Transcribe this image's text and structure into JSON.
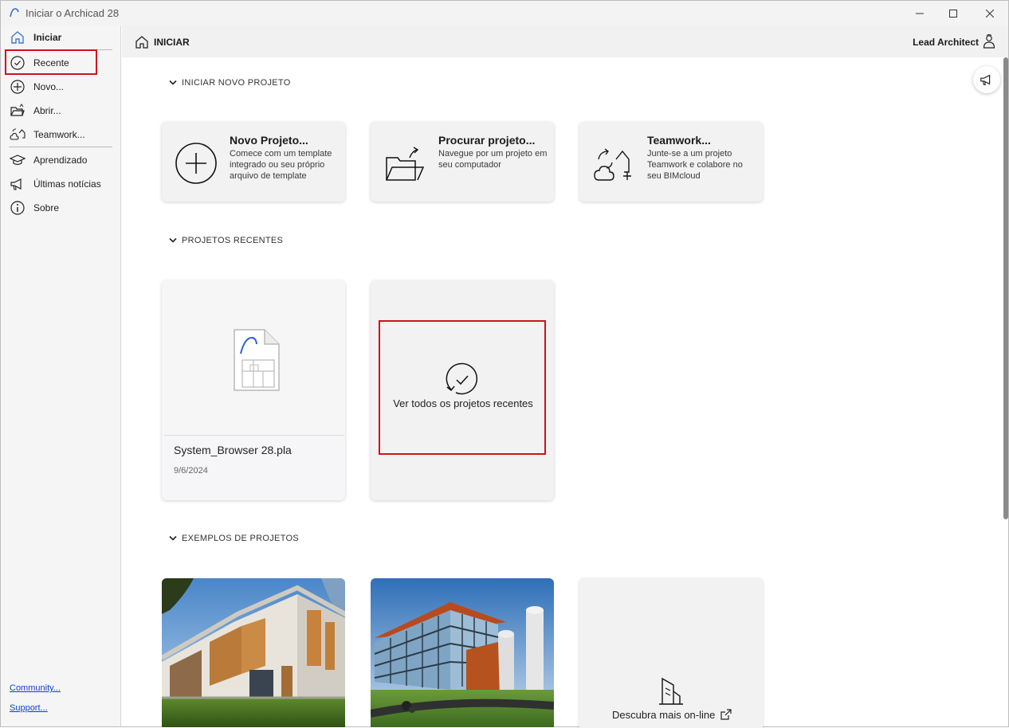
{
  "window": {
    "title": "Iniciar o Archicad 28",
    "controls": [
      "minimize",
      "maximize",
      "close"
    ]
  },
  "sidebar": {
    "items": [
      {
        "label": "Iniciar",
        "icon": "home-icon",
        "active": true
      },
      {
        "label": "Recente",
        "icon": "clock-check-icon",
        "highlighted": true
      },
      {
        "label": "Novo...",
        "icon": "plus-circle-icon"
      },
      {
        "label": "Abrir...",
        "icon": "folder-open-icon"
      },
      {
        "label": "Teamwork...",
        "icon": "teamwork-icon"
      },
      {
        "label": "Aprendizado",
        "icon": "graduation-cap-icon"
      },
      {
        "label": "Últimas notícias",
        "icon": "megaphone-icon"
      },
      {
        "label": "Sobre",
        "icon": "info-icon"
      }
    ],
    "links": [
      {
        "label": "Community..."
      },
      {
        "label": "Support..."
      }
    ]
  },
  "header": {
    "title": "INICIAR",
    "user": "Lead Architect"
  },
  "sections": {
    "new_project": {
      "title": "INICIAR NOVO PROJETO",
      "cards": [
        {
          "title": "Novo Projeto...",
          "description": "Comece com um template integrado ou seu próprio arquivo de template",
          "icon": "plus-circle-icon"
        },
        {
          "title": "Procurar projeto...",
          "description": "Navegue por um projeto em seu computador",
          "icon": "folder-open-icon"
        },
        {
          "title": "Teamwork...",
          "description": "Junte-se a um projeto Teamwork e colabore no seu BIMcloud",
          "icon": "teamwork-icon"
        }
      ]
    },
    "recent": {
      "title": "PROJETOS RECENTES",
      "items": [
        {
          "name": "System_Browser 28.pla",
          "date": "9/6/2024",
          "icon": "archicad-file-icon"
        }
      ],
      "view_all": {
        "label": "Ver todos os projetos recentes",
        "icon": "clock-check-icon",
        "highlighted": true
      }
    },
    "examples": {
      "title": "EXEMPLOS DE PROJETOS",
      "items": [
        {
          "image": "white-house-photo"
        },
        {
          "image": "glass-building-photo"
        }
      ],
      "discover": {
        "label": "Descubra mais on-line",
        "icon": "external-link-icon"
      }
    }
  },
  "colors": {
    "highlight": "#d0121a",
    "link": "#0a3fd6",
    "sidebar_bg": "#f5f5f5",
    "card_bg": "#f2f2f2"
  }
}
